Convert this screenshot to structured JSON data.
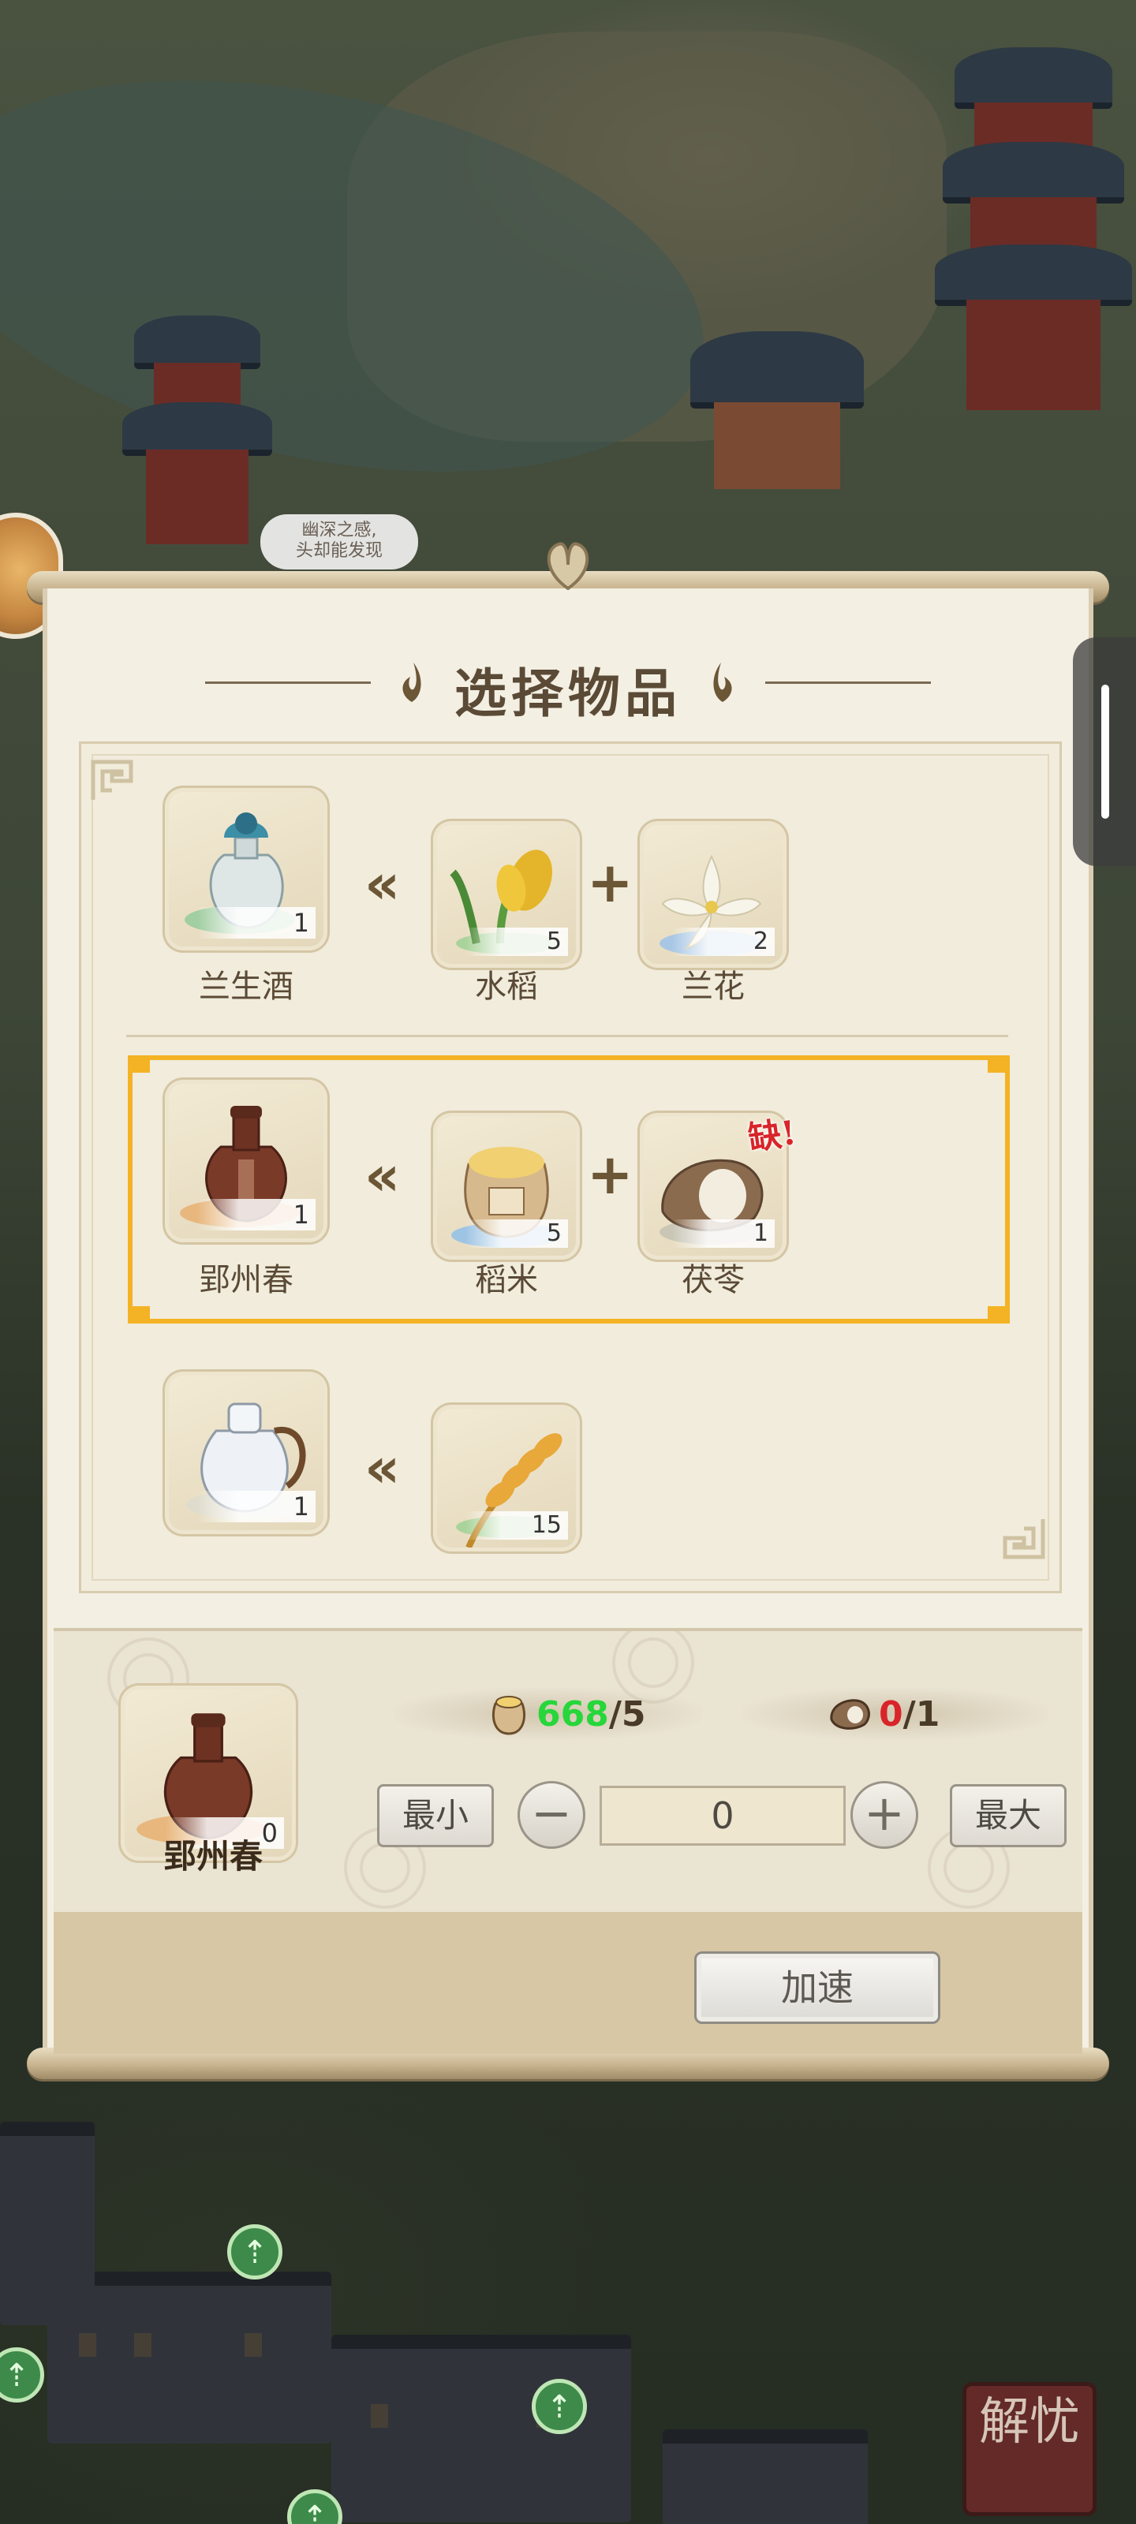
{
  "panel": {
    "title": "选择物品"
  },
  "recipes": [
    {
      "product": {
        "name": "兰生酒",
        "count": "1"
      },
      "ingredients": [
        {
          "name": "水稻",
          "count": "5"
        },
        {
          "name": "兰花",
          "count": "2"
        }
      ]
    },
    {
      "product": {
        "name": "郢州春",
        "count": "1"
      },
      "ingredients": [
        {
          "name": "稻米",
          "count": "5"
        },
        {
          "name": "茯苓",
          "count": "1",
          "badge": "缺!"
        }
      ],
      "selected": true
    },
    {
      "product": {
        "name": "",
        "count": "1"
      },
      "ingredients": [
        {
          "name": "",
          "count": "15"
        }
      ]
    }
  ],
  "production": {
    "item_name": "郢州春",
    "item_count": "0",
    "resources": [
      {
        "have": "668",
        "need": "/5",
        "status": "ok"
      },
      {
        "have": "0",
        "need": "/1",
        "status": "short"
      }
    ],
    "min_label": "最小",
    "max_label": "最大",
    "quantity": "0",
    "speed_label": "加速"
  },
  "background": {
    "notice_text": "幽深之感,\n头却能发现",
    "seal_text": "解忧"
  },
  "colors": {
    "selection": "#f4b324",
    "ok": "#27d63a",
    "short": "#d8242a"
  }
}
